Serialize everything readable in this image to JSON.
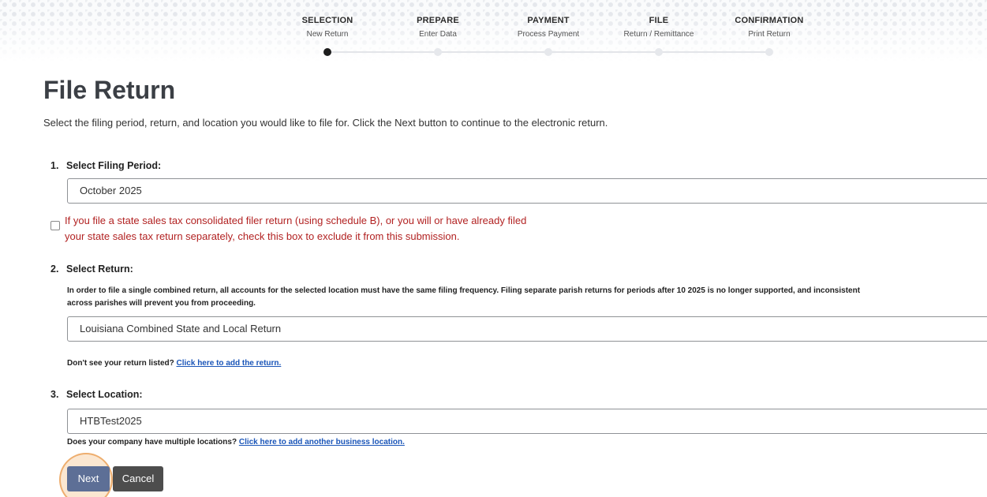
{
  "stepper": {
    "steps": [
      {
        "title": "SELECTION",
        "subtitle": "New Return",
        "active": true
      },
      {
        "title": "PREPARE",
        "subtitle": "Enter Data",
        "active": false
      },
      {
        "title": "PAYMENT",
        "subtitle": "Process Payment",
        "active": false
      },
      {
        "title": "FILE",
        "subtitle": "Return / Remittance",
        "active": false
      },
      {
        "title": "CONFIRMATION",
        "subtitle": "Print Return",
        "active": false
      }
    ]
  },
  "page": {
    "title": "File Return",
    "intro": "Select the filing period, return, and location you would like to file for. Click the Next button to continue to the electronic return."
  },
  "filing_period": {
    "number": "1.",
    "label": "Select Filing Period:",
    "value": "October 2025",
    "exclude_checked": false,
    "exclude_line1": "If you file a state sales tax consolidated filer return (using schedule B), or you will or have already filed",
    "exclude_line2": "your state sales tax return separately, check this box to exclude it from this submission."
  },
  "return": {
    "number": "2.",
    "label": "Select Return:",
    "note_line1": "In order to file a single combined return, all accounts for the selected location must have the same filing frequency. Filing separate parish returns for periods after 10 2025 is no longer supported, and inconsistent",
    "note_line2": "across parishes will prevent you from proceeding.",
    "value": "Louisiana Combined State and Local Return",
    "missing_prompt": "Don't see your return listed?",
    "missing_link": "Click here to add the return."
  },
  "location": {
    "number": "3.",
    "label": "Select Location:",
    "value": "HTBTest2025",
    "multi_prompt": "Does your company have multiple locations?",
    "multi_link": "Click here to add another business location."
  },
  "actions": {
    "next_label": "Next",
    "cancel_label": "Cancel"
  },
  "colors": {
    "warning_text": "#b22222",
    "link": "#1a55b8",
    "next_button": "#5d6f96",
    "cancel_button": "#4d4d4d",
    "click_highlight": "#e89646"
  }
}
